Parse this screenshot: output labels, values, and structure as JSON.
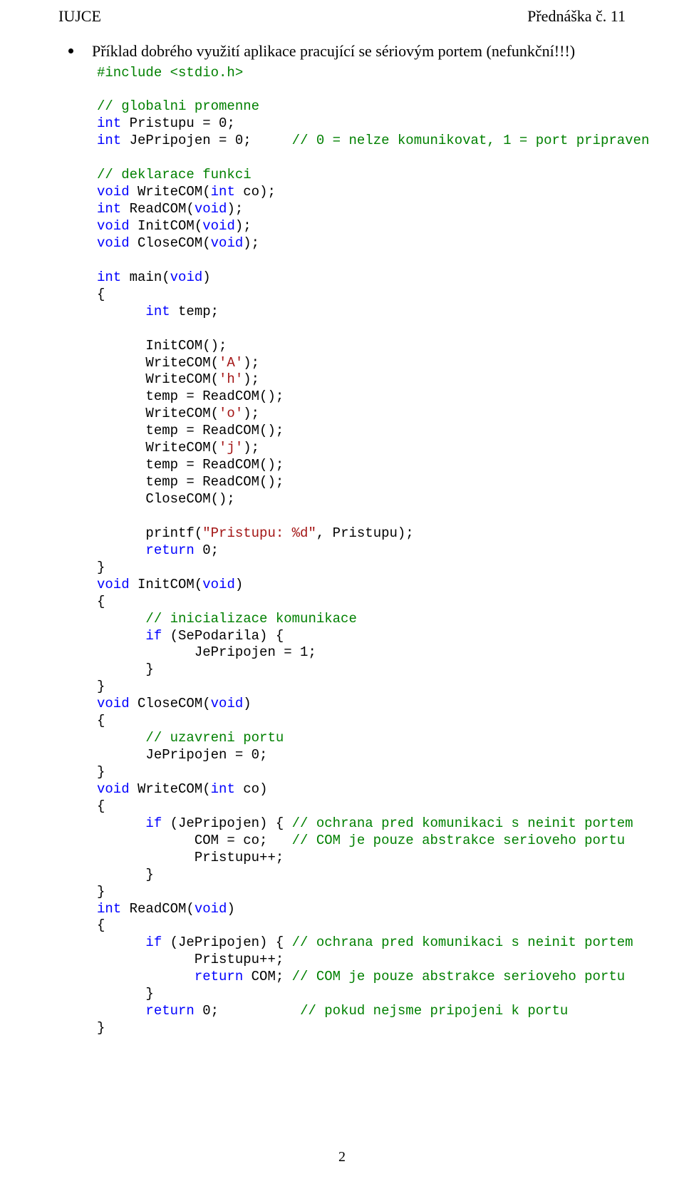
{
  "header": {
    "left": "IUJCE",
    "right": "Přednáška č. 11"
  },
  "bullet_text": "Příklad dobrého využití aplikace pracující se sériovým portem (nefunkční!!!)",
  "code": {
    "l1": "#include <stdio.h>",
    "l2": "// globalni promenne",
    "l3a": "int",
    "l3b": " Pristupu = 0;",
    "l4a": "int",
    "l4b": " JePripojen = 0;     ",
    "l4c": "// 0 = nelze komunikovat, 1 = port pripraven",
    "l5": "// deklarace funkci",
    "l6a": "void",
    "l6b": " WriteCOM(",
    "l6c": "int",
    "l6d": " co);",
    "l7a": "int",
    "l7b": " ReadCOM(",
    "l7c": "void",
    "l7d": ");",
    "l8a": "void",
    "l8b": " InitCOM(",
    "l8c": "void",
    "l8d": ");",
    "l9a": "void",
    "l9b": " CloseCOM(",
    "l9c": "void",
    "l9d": ");",
    "l10a": "int",
    "l10b": " main(",
    "l10c": "void",
    "l10d": ")",
    "l11": "{",
    "l12a": "      int",
    "l12b": " temp;",
    "l13": "      InitCOM();",
    "l14a": "      WriteCOM(",
    "l14b": "'A'",
    "l14c": ");",
    "l15a": "      WriteCOM(",
    "l15b": "'h'",
    "l15c": ");",
    "l16": "      temp = ReadCOM();",
    "l17a": "      WriteCOM(",
    "l17b": "'o'",
    "l17c": ");",
    "l18": "      temp = ReadCOM();",
    "l19a": "      WriteCOM(",
    "l19b": "'j'",
    "l19c": ");",
    "l20": "      temp = ReadCOM();",
    "l21": "      temp = ReadCOM();",
    "l22": "      CloseCOM();",
    "l23a": "      printf(",
    "l23b": "\"Pristupu: %d\"",
    "l23c": ", Pristupu);",
    "l24a": "      return",
    "l24b": " 0;",
    "l25": "}",
    "l26a": "void",
    "l26b": " InitCOM(",
    "l26c": "void",
    "l26d": ")",
    "l27": "{",
    "l28": "      // inicializace komunikace",
    "l29a": "      if",
    "l29b": " (SePodarila) {",
    "l30": "            JePripojen = 1;",
    "l31": "      }",
    "l32": "}",
    "l33a": "void",
    "l33b": " CloseCOM(",
    "l33c": "void",
    "l33d": ")",
    "l34": "{",
    "l35": "      // uzavreni portu",
    "l36": "      JePripojen = 0;",
    "l37": "}",
    "l38a": "void",
    "l38b": " WriteCOM(",
    "l38c": "int",
    "l38d": " co)",
    "l39": "{",
    "l40a": "      if",
    "l40b": " (JePripojen) { ",
    "l40c": "// ochrana pred komunikaci s neinit portem",
    "l41a": "            COM = co;   ",
    "l41b": "// COM je pouze abstrakce serioveho portu",
    "l42": "            Pristupu++;",
    "l43": "      }",
    "l44": "}",
    "l45a": "int",
    "l45b": " ReadCOM(",
    "l45c": "void",
    "l45d": ")",
    "l46": "{",
    "l47a": "      if",
    "l47b": " (JePripojen) { ",
    "l47c": "// ochrana pred komunikaci s neinit portem",
    "l48": "            Pristupu++;",
    "l49a": "            return",
    "l49b": " COM; ",
    "l49c": "// COM je pouze abstrakce serioveho portu",
    "l50": "      }",
    "l51a": "      return",
    "l51b": " 0;          ",
    "l51c": "// pokud nejsme pripojeni k portu",
    "l52": "}"
  },
  "page_num": "2"
}
